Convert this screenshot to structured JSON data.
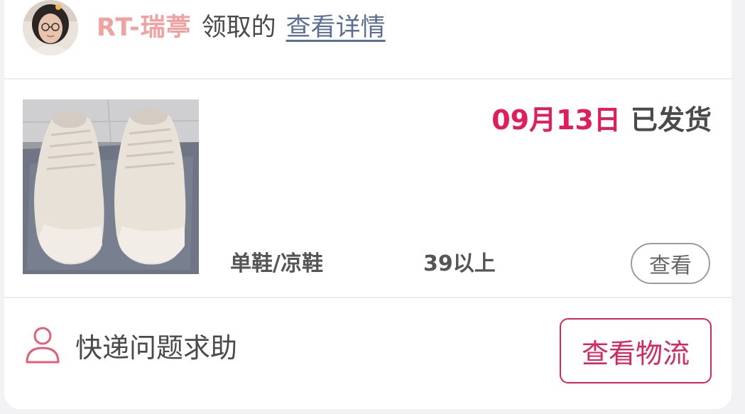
{
  "header": {
    "username": "RT-瑞葶",
    "action_text": "领取的",
    "details_link": "查看详情"
  },
  "product": {
    "ship_date": "09月13日",
    "ship_status": "已发货",
    "category": "单鞋/凉鞋",
    "size": "39以上",
    "view_button": "查看"
  },
  "footer": {
    "help_text": "快递问题求助",
    "logistics_button": "查看物流"
  },
  "colors": {
    "accent": "#e31c5a",
    "username": "#f0a2a2",
    "link": "#5b6f95",
    "text": "#4a4a4a"
  },
  "icons": {
    "help": "person-outline-icon",
    "avatar": "user-avatar"
  }
}
